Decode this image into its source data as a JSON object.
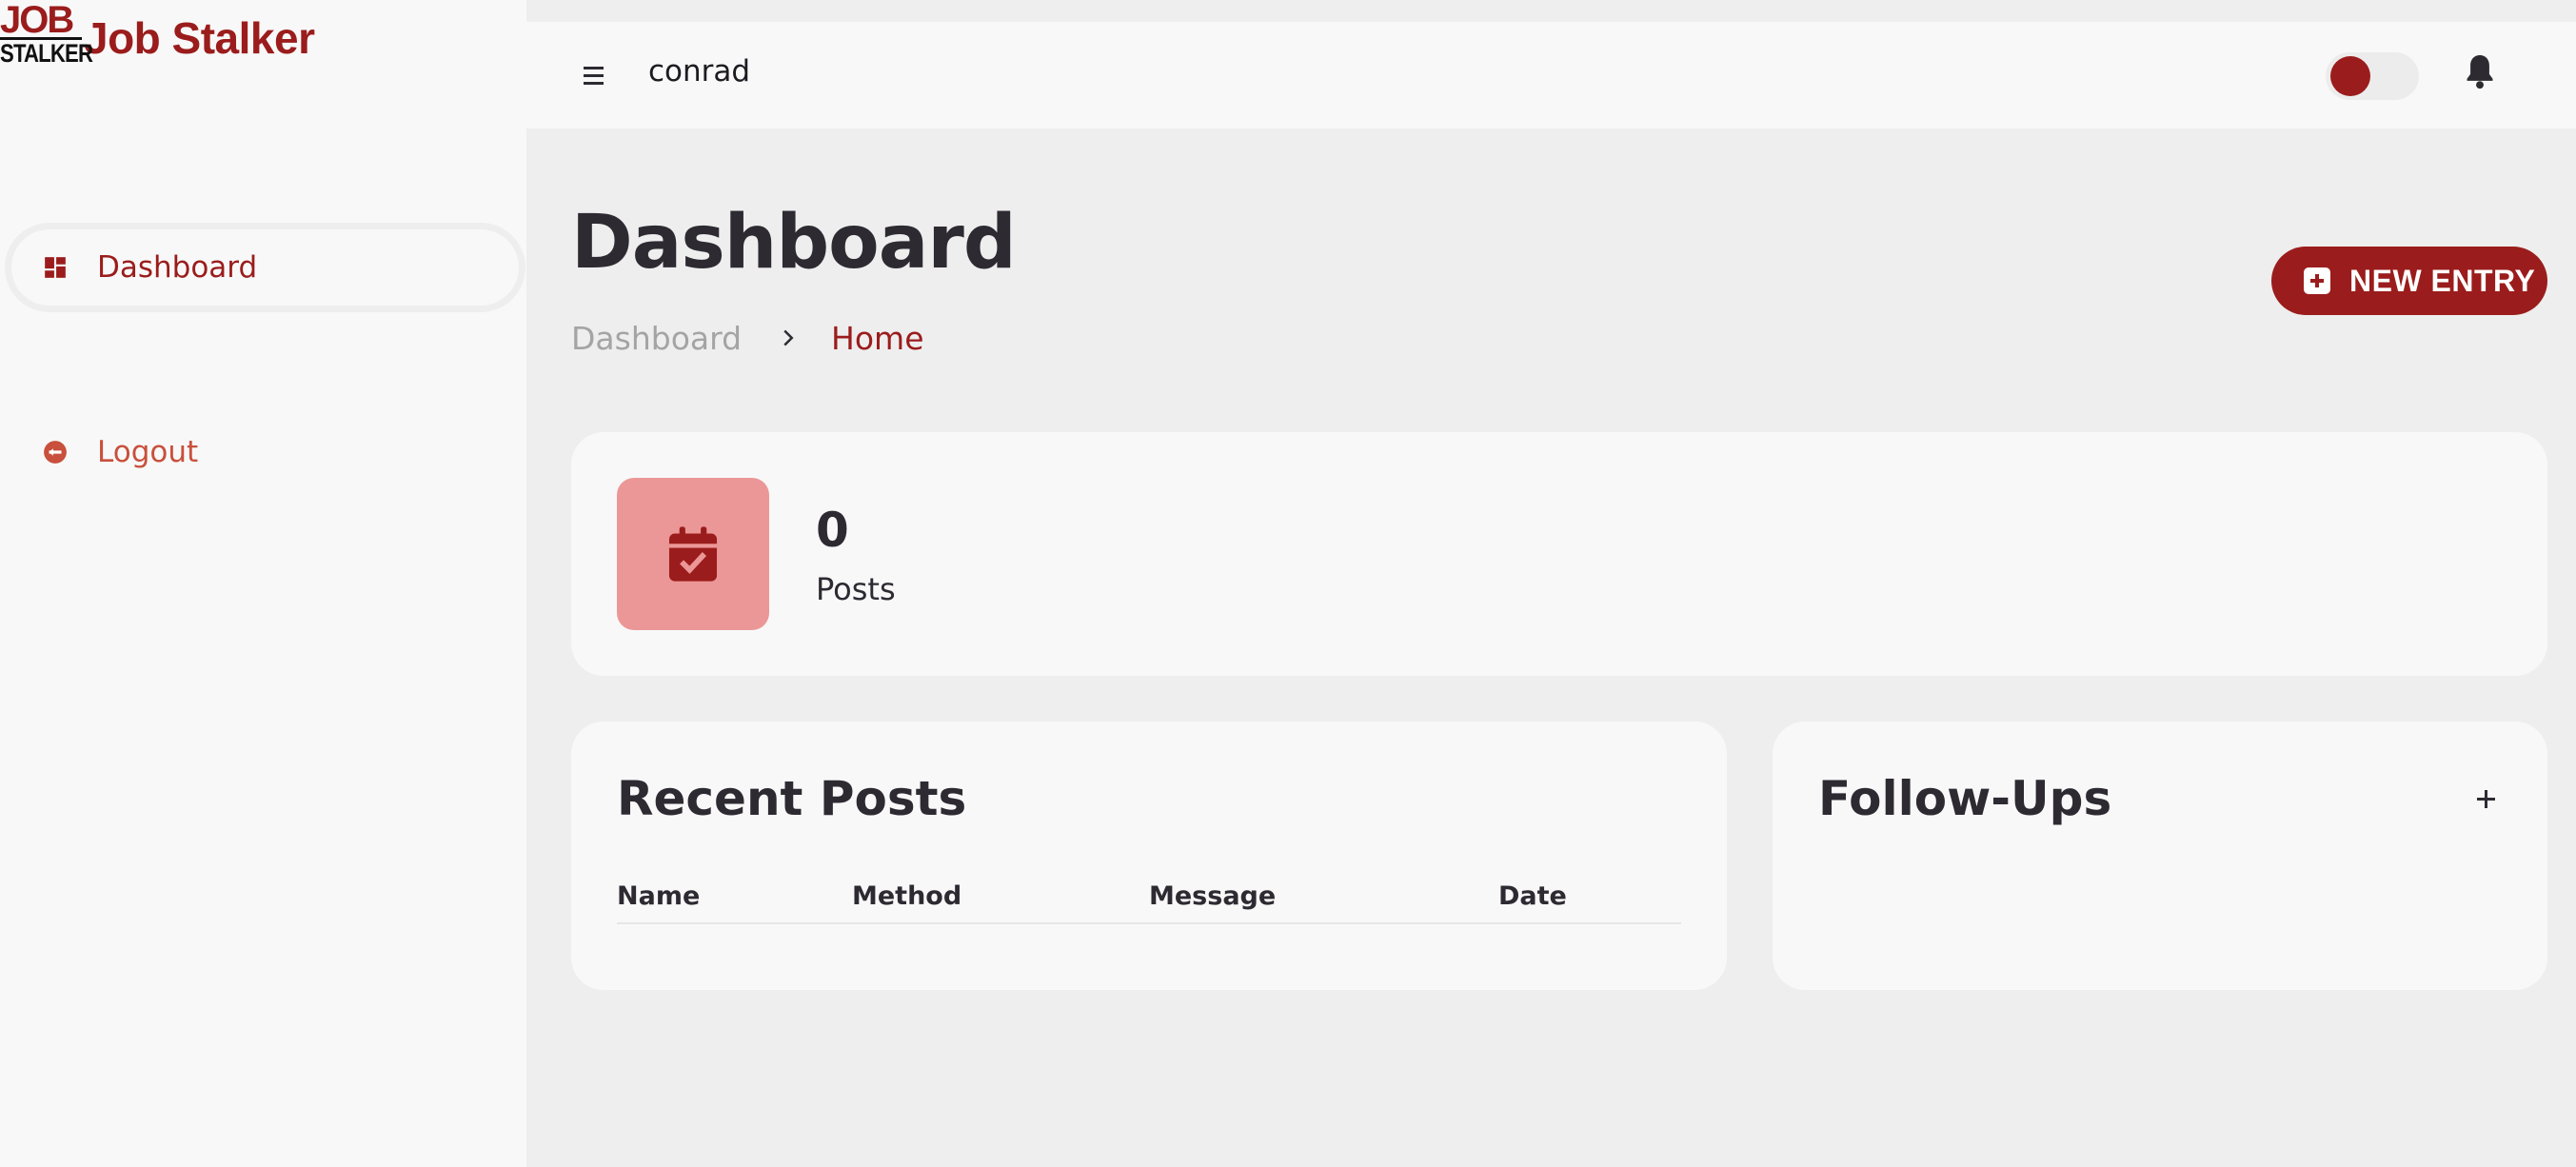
{
  "brand": {
    "logo_top": "JOB",
    "logo_bottom": "STALKER",
    "name": "Job Stalker",
    "accent_color": "#9b1c1c"
  },
  "sidebar": {
    "items": [
      {
        "label": "Dashboard",
        "icon": "dashboard-icon",
        "active": true
      },
      {
        "label": "Logout",
        "icon": "logout-icon",
        "active": false
      }
    ]
  },
  "header": {
    "menu_icon": "hamburger-menu-icon",
    "username": "conrad",
    "theme_toggle_icon": "toggle-switch",
    "notifications_icon": "bell-icon"
  },
  "page": {
    "title": "Dashboard",
    "breadcrumb": [
      "Dashboard",
      "Home"
    ],
    "breadcrumb_separator_icon": "chevron-right-icon",
    "new_entry_label": "NEW ENTRY",
    "new_entry_icon": "plus-square-icon"
  },
  "stats": {
    "value": "0",
    "label": "Posts",
    "icon": "calendar-check-icon",
    "icon_bg_color": "#ec9797"
  },
  "recent_posts": {
    "title": "Recent Posts",
    "columns": [
      "Name",
      "Method",
      "Message",
      "Date"
    ],
    "rows": []
  },
  "follow_ups": {
    "title": "Follow-Ups",
    "add_icon": "plus-icon"
  }
}
